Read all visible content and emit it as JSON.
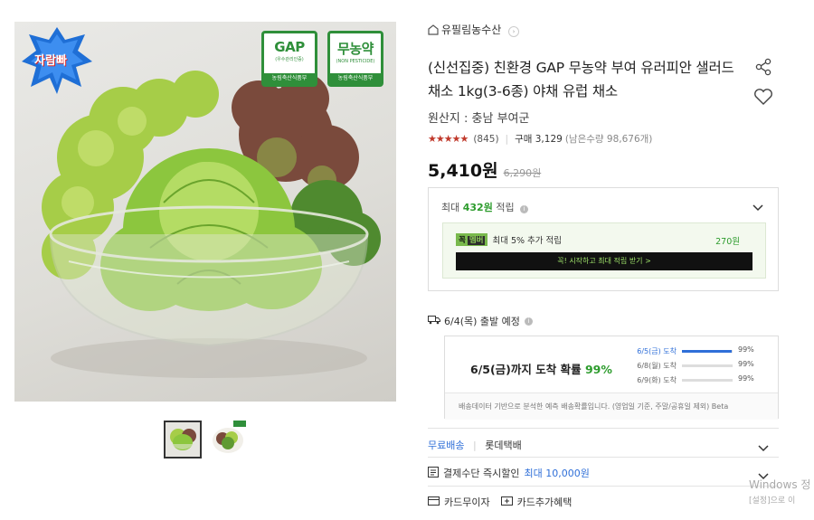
{
  "badge_zz": "자람빠",
  "certs": [
    {
      "big": "GAP",
      "small": "(우수관리인증)",
      "bar": "농림축산식품부"
    },
    {
      "big": "무농약",
      "small": "(NON PESTICIDE)",
      "bar": "농림축산식품부"
    }
  ],
  "store": {
    "name": "유필림농수산",
    "icon": "store-icon"
  },
  "product": {
    "title": "(신선집중) 친환경 GAP 무농약 부여 유러피안 샐러드 채소 1kg(3-6종) 야채 유럽 채소",
    "origin": "원산지 : 충남 부여군",
    "rating_value": 4.5,
    "reviews": "(845)",
    "purchases": "구매 3,129",
    "stock": "(남은수량 98,676개)",
    "price": "5,410원",
    "original_price": "6,290원"
  },
  "points": {
    "prefix": "최대 ",
    "amount": "432원",
    "suffix": " 적립",
    "member_badge": "꼭",
    "member_badge2": "멤버",
    "member_text": "최대 5% 추가 적립",
    "member_amount": "270원",
    "cta": "꼭! 시작하고 최대 적립 받기 >"
  },
  "shipping": {
    "depart": "6/4(목) 출발 예정",
    "prob_prefix": "6/5(금)까지 도착 확률 ",
    "prob_value": "99%",
    "rows": [
      {
        "label": "6/5(금) 도착",
        "value": 0.99,
        "pct": "99%"
      },
      {
        "label": "6/8(월) 도착",
        "value": 0.99,
        "pct": "99%"
      },
      {
        "label": "6/9(화) 도착",
        "value": 0.99,
        "pct": "99%"
      }
    ],
    "footnote": "배송데이터 기반으로 분석한 예측 배송확률입니다. (영업일 기준, 주말/공휴일 제외) Beta"
  },
  "delivery": {
    "free": "무료배송",
    "carrier": "롯데택배"
  },
  "payment": {
    "label": "결제수단 즉시할인",
    "amount": "최대 10,000원"
  },
  "card": {
    "interest_free": "카드무이자",
    "extra": "카드추가혜택"
  },
  "windows": {
    "line1": "Windows 정",
    "line2": "[설정]으로 이"
  },
  "colors": {
    "green": "#2d9c2d",
    "blue": "#2f6fd8",
    "red_star": "#c0392b"
  }
}
